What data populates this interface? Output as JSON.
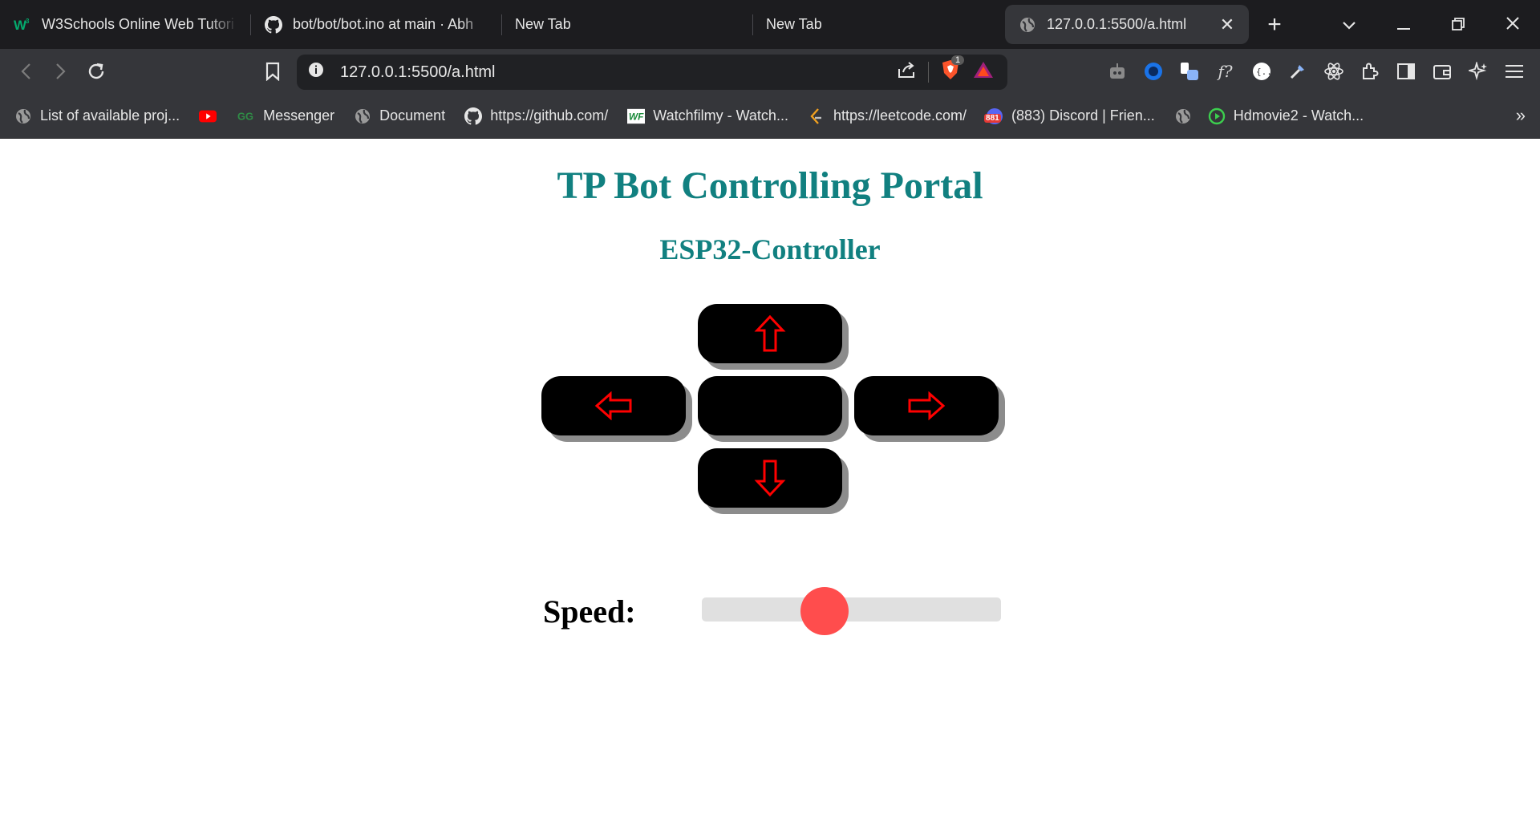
{
  "browser": {
    "tabs": [
      {
        "title": "W3Schools Online Web Tutori",
        "icon": "w3schools-icon"
      },
      {
        "title": "bot/bot/bot.ino at main · Abh",
        "icon": "github-icon"
      },
      {
        "title": "New Tab",
        "icon": ""
      },
      {
        "title": "New Tab",
        "icon": ""
      },
      {
        "title": "127.0.0.1:5500/a.html",
        "icon": "globe-icon",
        "active": true
      }
    ],
    "url": "127.0.0.1:5500/a.html",
    "brave_badge": "1",
    "bookmarks": [
      {
        "label": "List of available proj...",
        "icon": "globe-icon"
      },
      {
        "label": "",
        "icon": "youtube-icon"
      },
      {
        "label": "Messenger",
        "icon": "geeksforgeeks-icon"
      },
      {
        "label": "Document",
        "icon": "globe-icon"
      },
      {
        "label": "https://github.com/",
        "icon": "github-icon"
      },
      {
        "label": "Watchfilmy - Watch...",
        "icon": "watchfilmy-icon"
      },
      {
        "label": "https://leetcode.com/",
        "icon": "leetcode-icon"
      },
      {
        "label": "(883) Discord | Frien...",
        "icon": "discord-icon"
      },
      {
        "label": "",
        "icon": "globe-icon"
      },
      {
        "label": "Hdmovie2 - Watch...",
        "icon": "play-icon"
      }
    ],
    "discord_badge": "881"
  },
  "page": {
    "title": "TP Bot Controlling Portal",
    "subtitle": "ESP32-Controller",
    "controls": {
      "up": "⇧",
      "down": "⇩",
      "left": "⇦",
      "right": "⇨"
    },
    "speed_label": "Speed:",
    "speed_value": 0.41
  },
  "colors": {
    "heading": "#118080",
    "arrow": "#ff0000",
    "button": "#000000",
    "slider_thumb": "#ff4d4d",
    "slider_track": "#e0e0e0"
  }
}
